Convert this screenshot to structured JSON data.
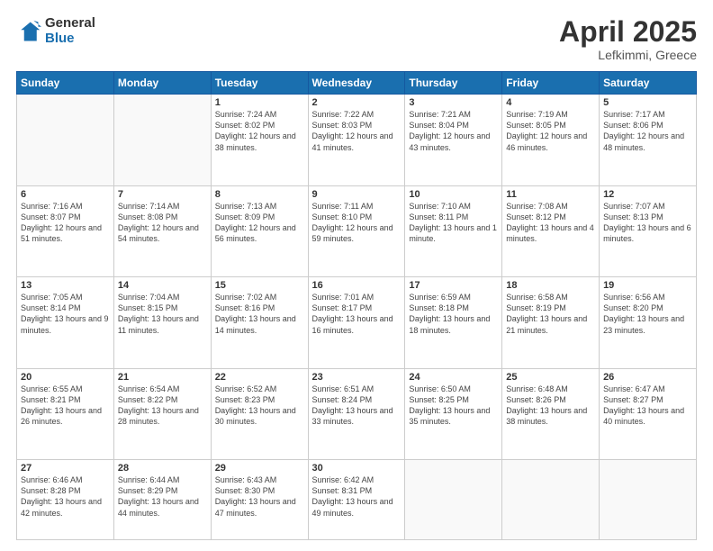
{
  "header": {
    "logo_line1": "General",
    "logo_line2": "Blue",
    "title": "April 2025",
    "subtitle": "Lefkimmi, Greece"
  },
  "days_of_week": [
    "Sunday",
    "Monday",
    "Tuesday",
    "Wednesday",
    "Thursday",
    "Friday",
    "Saturday"
  ],
  "weeks": [
    [
      {
        "day": "",
        "info": ""
      },
      {
        "day": "",
        "info": ""
      },
      {
        "day": "1",
        "info": "Sunrise: 7:24 AM\nSunset: 8:02 PM\nDaylight: 12 hours and 38 minutes."
      },
      {
        "day": "2",
        "info": "Sunrise: 7:22 AM\nSunset: 8:03 PM\nDaylight: 12 hours and 41 minutes."
      },
      {
        "day": "3",
        "info": "Sunrise: 7:21 AM\nSunset: 8:04 PM\nDaylight: 12 hours and 43 minutes."
      },
      {
        "day": "4",
        "info": "Sunrise: 7:19 AM\nSunset: 8:05 PM\nDaylight: 12 hours and 46 minutes."
      },
      {
        "day": "5",
        "info": "Sunrise: 7:17 AM\nSunset: 8:06 PM\nDaylight: 12 hours and 48 minutes."
      }
    ],
    [
      {
        "day": "6",
        "info": "Sunrise: 7:16 AM\nSunset: 8:07 PM\nDaylight: 12 hours and 51 minutes."
      },
      {
        "day": "7",
        "info": "Sunrise: 7:14 AM\nSunset: 8:08 PM\nDaylight: 12 hours and 54 minutes."
      },
      {
        "day": "8",
        "info": "Sunrise: 7:13 AM\nSunset: 8:09 PM\nDaylight: 12 hours and 56 minutes."
      },
      {
        "day": "9",
        "info": "Sunrise: 7:11 AM\nSunset: 8:10 PM\nDaylight: 12 hours and 59 minutes."
      },
      {
        "day": "10",
        "info": "Sunrise: 7:10 AM\nSunset: 8:11 PM\nDaylight: 13 hours and 1 minute."
      },
      {
        "day": "11",
        "info": "Sunrise: 7:08 AM\nSunset: 8:12 PM\nDaylight: 13 hours and 4 minutes."
      },
      {
        "day": "12",
        "info": "Sunrise: 7:07 AM\nSunset: 8:13 PM\nDaylight: 13 hours and 6 minutes."
      }
    ],
    [
      {
        "day": "13",
        "info": "Sunrise: 7:05 AM\nSunset: 8:14 PM\nDaylight: 13 hours and 9 minutes."
      },
      {
        "day": "14",
        "info": "Sunrise: 7:04 AM\nSunset: 8:15 PM\nDaylight: 13 hours and 11 minutes."
      },
      {
        "day": "15",
        "info": "Sunrise: 7:02 AM\nSunset: 8:16 PM\nDaylight: 13 hours and 14 minutes."
      },
      {
        "day": "16",
        "info": "Sunrise: 7:01 AM\nSunset: 8:17 PM\nDaylight: 13 hours and 16 minutes."
      },
      {
        "day": "17",
        "info": "Sunrise: 6:59 AM\nSunset: 8:18 PM\nDaylight: 13 hours and 18 minutes."
      },
      {
        "day": "18",
        "info": "Sunrise: 6:58 AM\nSunset: 8:19 PM\nDaylight: 13 hours and 21 minutes."
      },
      {
        "day": "19",
        "info": "Sunrise: 6:56 AM\nSunset: 8:20 PM\nDaylight: 13 hours and 23 minutes."
      }
    ],
    [
      {
        "day": "20",
        "info": "Sunrise: 6:55 AM\nSunset: 8:21 PM\nDaylight: 13 hours and 26 minutes."
      },
      {
        "day": "21",
        "info": "Sunrise: 6:54 AM\nSunset: 8:22 PM\nDaylight: 13 hours and 28 minutes."
      },
      {
        "day": "22",
        "info": "Sunrise: 6:52 AM\nSunset: 8:23 PM\nDaylight: 13 hours and 30 minutes."
      },
      {
        "day": "23",
        "info": "Sunrise: 6:51 AM\nSunset: 8:24 PM\nDaylight: 13 hours and 33 minutes."
      },
      {
        "day": "24",
        "info": "Sunrise: 6:50 AM\nSunset: 8:25 PM\nDaylight: 13 hours and 35 minutes."
      },
      {
        "day": "25",
        "info": "Sunrise: 6:48 AM\nSunset: 8:26 PM\nDaylight: 13 hours and 38 minutes."
      },
      {
        "day": "26",
        "info": "Sunrise: 6:47 AM\nSunset: 8:27 PM\nDaylight: 13 hours and 40 minutes."
      }
    ],
    [
      {
        "day": "27",
        "info": "Sunrise: 6:46 AM\nSunset: 8:28 PM\nDaylight: 13 hours and 42 minutes."
      },
      {
        "day": "28",
        "info": "Sunrise: 6:44 AM\nSunset: 8:29 PM\nDaylight: 13 hours and 44 minutes."
      },
      {
        "day": "29",
        "info": "Sunrise: 6:43 AM\nSunset: 8:30 PM\nDaylight: 13 hours and 47 minutes."
      },
      {
        "day": "30",
        "info": "Sunrise: 6:42 AM\nSunset: 8:31 PM\nDaylight: 13 hours and 49 minutes."
      },
      {
        "day": "",
        "info": ""
      },
      {
        "day": "",
        "info": ""
      },
      {
        "day": "",
        "info": ""
      }
    ]
  ]
}
